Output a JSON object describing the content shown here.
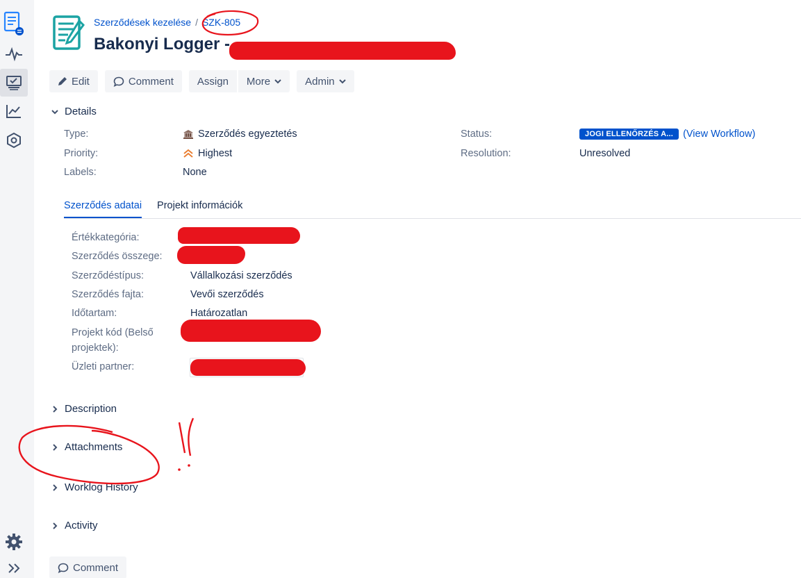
{
  "breadcrumb": {
    "project": "Szerződések kezelése",
    "separator": "/",
    "issue_key": "SZK-805"
  },
  "issue": {
    "title_visible": "Bakonyi Logger -"
  },
  "toolbar": {
    "edit": "Edit",
    "comment": "Comment",
    "assign": "Assign",
    "more": "More",
    "admin": "Admin"
  },
  "details": {
    "heading": "Details",
    "type_label": "Type:",
    "type_value": "Szerződés egyeztetés",
    "priority_label": "Priority:",
    "priority_value": "Highest",
    "labels_label": "Labels:",
    "labels_value": "None",
    "status_label": "Status:",
    "status_value": "JOGI ELLENŐRZÉS A...",
    "view_workflow": "(View Workflow)",
    "resolution_label": "Resolution:",
    "resolution_value": "Unresolved"
  },
  "tabs": [
    {
      "label": "Szerződés adatai"
    },
    {
      "label": "Projekt információk"
    }
  ],
  "fields": {
    "value_category": "Értékkategória:",
    "contract_amount": "Szerződés összege:",
    "contract_type": "Szerződéstípus:",
    "contract_type_value": "Vállalkozási szerződés",
    "contract_kind": "Szerződés fajta:",
    "contract_kind_value": "Vevői szerződés",
    "duration": "Időtartam:",
    "duration_value": "Határozatlan",
    "project_code": "Projekt kód (Belső projektek):",
    "business_partner": "Üzleti partner:"
  },
  "sections": {
    "description": "Description",
    "attachments": "Attachments",
    "worklog": "Worklog History",
    "activity": "Activity"
  },
  "bottom": {
    "comment": "Comment"
  },
  "colors": {
    "accent": "#0052cc",
    "text": "#172b4d",
    "muted": "#5e6c84",
    "button_bg": "#f4f5f7",
    "annotation_red": "#e8141c"
  }
}
